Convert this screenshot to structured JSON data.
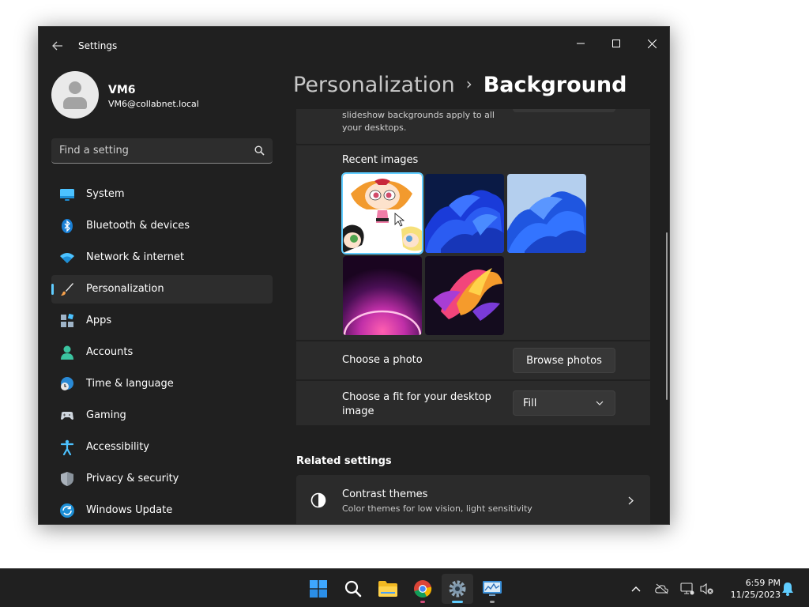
{
  "window": {
    "title": "Settings"
  },
  "profile": {
    "name": "VM6",
    "email": "VM6@collabnet.local"
  },
  "search": {
    "placeholder": "Find a setting"
  },
  "sidebar": {
    "items": [
      {
        "label": "System",
        "icon": "system-icon",
        "selected": false
      },
      {
        "label": "Bluetooth & devices",
        "icon": "bluetooth-icon",
        "selected": false
      },
      {
        "label": "Network & internet",
        "icon": "wifi-icon",
        "selected": false
      },
      {
        "label": "Personalization",
        "icon": "brush-icon",
        "selected": true
      },
      {
        "label": "Apps",
        "icon": "apps-icon",
        "selected": false
      },
      {
        "label": "Accounts",
        "icon": "person-icon",
        "selected": false
      },
      {
        "label": "Time & language",
        "icon": "globe-clock-icon",
        "selected": false
      },
      {
        "label": "Gaming",
        "icon": "gamepad-icon",
        "selected": false
      },
      {
        "label": "Accessibility",
        "icon": "accessibility-icon",
        "selected": false
      },
      {
        "label": "Privacy & security",
        "icon": "shield-icon",
        "selected": false
      },
      {
        "label": "Windows Update",
        "icon": "update-icon",
        "selected": false
      }
    ]
  },
  "header": {
    "breadcrumb_parent": "Personalization",
    "breadcrumb_separator": "›",
    "breadcrumb_current": "Background"
  },
  "background": {
    "slideshow_note": "slideshow backgrounds apply to all your desktops.",
    "recent_images_label": "Recent images",
    "recent_images": [
      {
        "name": "Powerpuff Girls wallpaper",
        "selected": true
      },
      {
        "name": "Blue bloom dark wallpaper",
        "selected": false
      },
      {
        "name": "Blue bloom light wallpaper",
        "selected": false
      },
      {
        "name": "Purple glow wallpaper",
        "selected": false
      },
      {
        "name": "Colorful flow wallpaper",
        "selected": false
      }
    ],
    "choose_photo_label": "Choose a photo",
    "browse_button": "Browse photos",
    "choose_fit_label": "Choose a fit for your desktop image",
    "fit_value": "Fill"
  },
  "related": {
    "heading": "Related settings",
    "contrast_title": "Contrast themes",
    "contrast_desc": "Color themes for low vision, light sensitivity"
  },
  "taskbar": {
    "time": "6:59 PM",
    "date": "11/25/2023"
  },
  "colors": {
    "accent": "#60cdff",
    "window_bg": "#202020",
    "card_bg": "#2b2b2b"
  }
}
